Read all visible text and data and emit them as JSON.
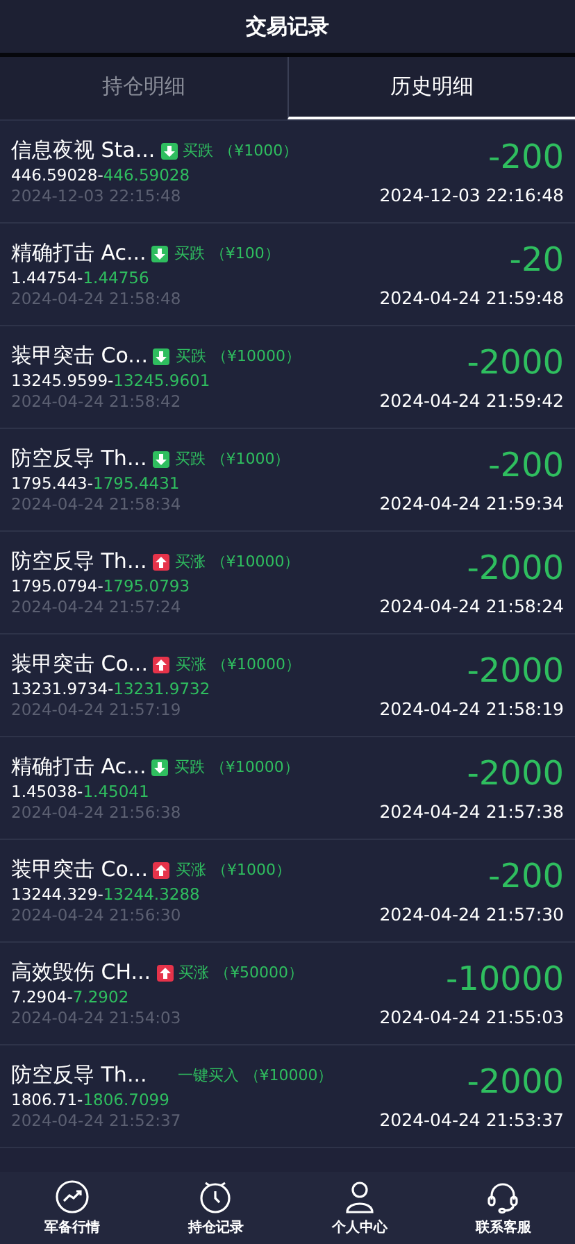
{
  "header": {
    "title": "交易记录"
  },
  "tabs": [
    {
      "label": "持仓明细",
      "selected": false
    },
    {
      "label": "历史明细",
      "selected": true
    }
  ],
  "records": [
    {
      "name": "信息夜视 Sta...",
      "kind": "down",
      "label": "买跌",
      "amount": "（¥1000）",
      "open": "446.59028-",
      "close": "446.59028",
      "open_time": "2024-12-03 22:15:48",
      "profit": "-200",
      "close_time": "2024-12-03 22:16:48"
    },
    {
      "name": "精确打击 Ac...",
      "kind": "down",
      "label": "买跌",
      "amount": "（¥100）",
      "open": "1.44754-",
      "close": "1.44756",
      "open_time": "2024-04-24 21:58:48",
      "profit": "-20",
      "close_time": "2024-04-24 21:59:48"
    },
    {
      "name": "装甲突击 Co...",
      "kind": "down",
      "label": "买跌",
      "amount": "（¥10000）",
      "open": "13245.9599-",
      "close": "13245.9601",
      "open_time": "2024-04-24 21:58:42",
      "profit": "-2000",
      "close_time": "2024-04-24 21:59:42"
    },
    {
      "name": "防空反导 Th...",
      "kind": "down",
      "label": "买跌",
      "amount": "（¥1000）",
      "open": "1795.443-",
      "close": "1795.4431",
      "open_time": "2024-04-24 21:58:34",
      "profit": "-200",
      "close_time": "2024-04-24 21:59:34"
    },
    {
      "name": "防空反导 Th...",
      "kind": "up",
      "label": "买涨",
      "amount": "（¥10000）",
      "open": "1795.0794-",
      "close": "1795.0793",
      "open_time": "2024-04-24 21:57:24",
      "profit": "-2000",
      "close_time": "2024-04-24 21:58:24"
    },
    {
      "name": "装甲突击 Co...",
      "kind": "up",
      "label": "买涨",
      "amount": "（¥10000）",
      "open": "13231.9734-",
      "close": "13231.9732",
      "open_time": "2024-04-24 21:57:19",
      "profit": "-2000",
      "close_time": "2024-04-24 21:58:19"
    },
    {
      "name": "精确打击 Ac...",
      "kind": "down",
      "label": "买跌",
      "amount": "（¥10000）",
      "open": "1.45038-",
      "close": "1.45041",
      "open_time": "2024-04-24 21:56:38",
      "profit": "-2000",
      "close_time": "2024-04-24 21:57:38"
    },
    {
      "name": "装甲突击 Co...",
      "kind": "up",
      "label": "买涨",
      "amount": "（¥1000）",
      "open": "13244.329-",
      "close": "13244.3288",
      "open_time": "2024-04-24 21:56:30",
      "profit": "-200",
      "close_time": "2024-04-24 21:57:30"
    },
    {
      "name": "高效毁伤 CH...",
      "kind": "up",
      "label": "买涨",
      "amount": "（¥50000）",
      "open": "7.2904-",
      "close": "7.2902",
      "open_time": "2024-04-24 21:54:03",
      "profit": "-10000",
      "close_time": "2024-04-24 21:55:03"
    },
    {
      "name": "防空反导 Th...",
      "kind": "oneclick",
      "label": "一键买入",
      "amount": "（¥10000）",
      "open": "1806.71-",
      "close": "1806.7099",
      "open_time": "2024-04-24 21:52:37",
      "profit": "-2000",
      "close_time": "2024-04-24 21:53:37"
    }
  ],
  "nav": [
    {
      "kind": "market",
      "label": "军备行情"
    },
    {
      "kind": "clock",
      "label": "持仓记录"
    },
    {
      "kind": "person",
      "label": "个人中心"
    },
    {
      "kind": "headset",
      "label": "联系客服"
    }
  ]
}
